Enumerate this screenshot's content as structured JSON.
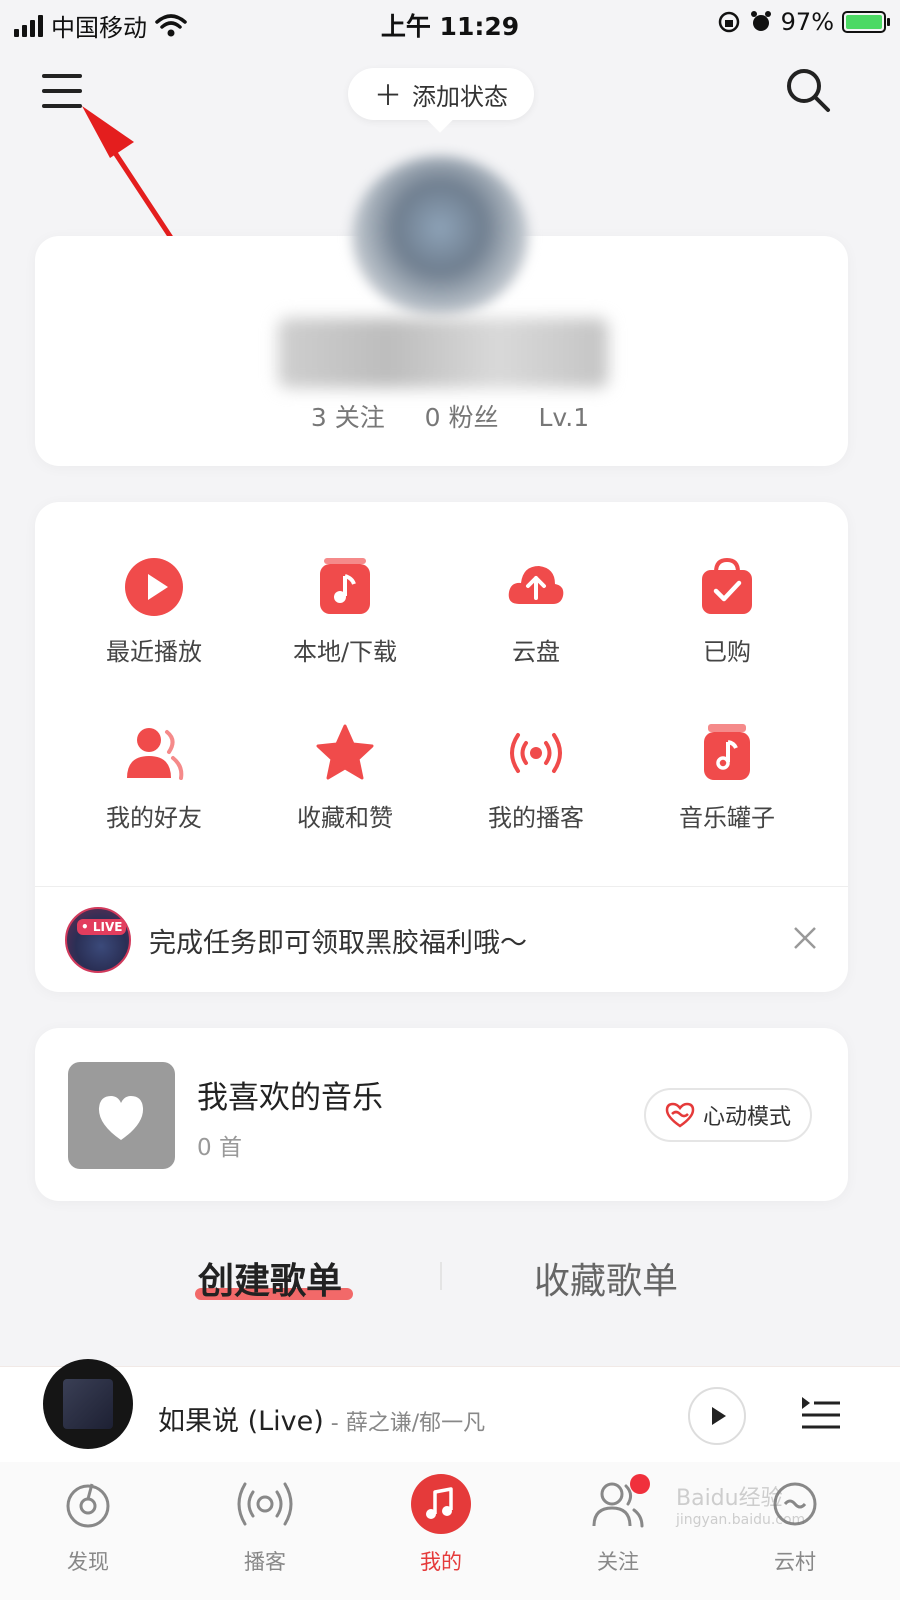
{
  "status_bar": {
    "carrier": "中国移动",
    "time": "上午 11:29",
    "battery": "97%"
  },
  "top": {
    "add_status": "添加状态"
  },
  "profile": {
    "follow": "3 关注",
    "fans": "0 粉丝",
    "level": "Lv.1"
  },
  "grid": {
    "items": [
      {
        "label": "最近播放",
        "icon": "play-icon"
      },
      {
        "label": "本地/下载",
        "icon": "local-music-icon"
      },
      {
        "label": "云盘",
        "icon": "cloud-upload-icon"
      },
      {
        "label": "已购",
        "icon": "purchased-bag-icon"
      },
      {
        "label": "我的好友",
        "icon": "friends-icon"
      },
      {
        "label": "收藏和赞",
        "icon": "star-icon"
      },
      {
        "label": "我的播客",
        "icon": "podcast-icon"
      },
      {
        "label": "音乐罐子",
        "icon": "music-jar-icon"
      }
    ]
  },
  "task": {
    "live_tag": "• LIVE",
    "text": "完成任务即可领取黑胶福利哦～"
  },
  "favorite": {
    "title": "我喜欢的音乐",
    "count": "0 首",
    "mode_btn": "心动模式"
  },
  "tabs": {
    "create": "创建歌单",
    "collect": "收藏歌单"
  },
  "player": {
    "song": "如果说 (Live)",
    "artist": " - 薛之谦/郁一凡"
  },
  "nav": {
    "items": [
      {
        "label": "发现"
      },
      {
        "label": "播客"
      },
      {
        "label": "我的"
      },
      {
        "label": "关注"
      },
      {
        "label": "云村"
      }
    ]
  },
  "watermark": {
    "line1": "Baidu经验",
    "line2": "jingyan.baidu.com"
  },
  "colors": {
    "accent": "#e53a3a",
    "icon_red": "#f04b4b"
  }
}
